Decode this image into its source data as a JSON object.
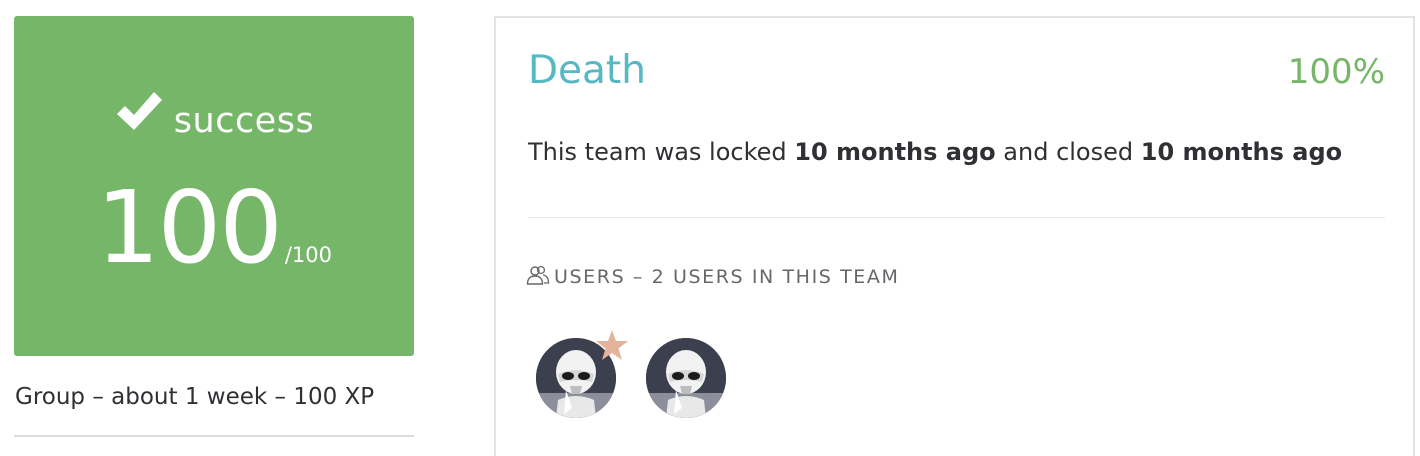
{
  "score_card": {
    "status": "success",
    "score": "100",
    "max": "/100",
    "background": "#76b669",
    "status_icon": "checkmark-icon"
  },
  "meta": {
    "text": "Group – about 1 week – 100 XP"
  },
  "team": {
    "name": "Death",
    "percent": "100%",
    "lock_prefix": "This team was locked ",
    "locked_ago": "10 months ago",
    "lock_middle": " and closed ",
    "closed_ago": "10 months ago",
    "name_color": "#56b8c3",
    "percent_color": "#76b669"
  },
  "users": {
    "heading": "USERS – 2 USERS IN THIS TEAM",
    "heading_icon": "users-icon",
    "members": [
      {
        "avatar": "stormtrooper-avatar",
        "is_leader": true,
        "badge_icon": "star-icon",
        "badge_color": "#e4b49a"
      },
      {
        "avatar": "stormtrooper-avatar",
        "is_leader": false
      }
    ]
  }
}
